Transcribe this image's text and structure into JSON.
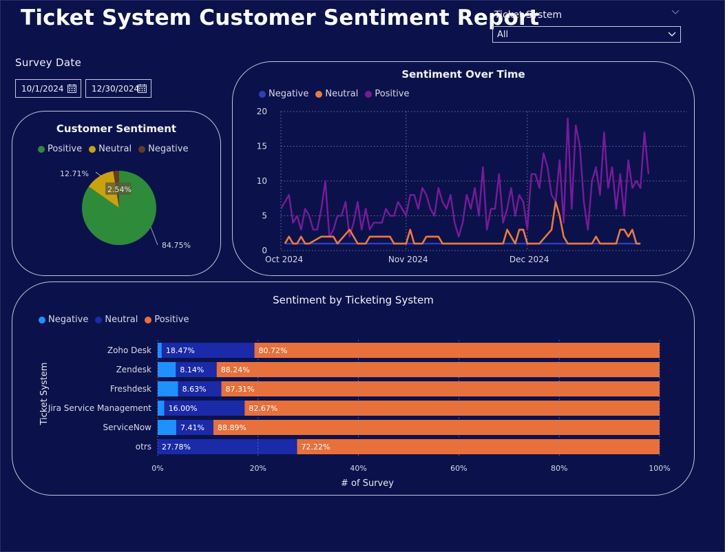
{
  "header": {
    "title": "Ticket System Customer Sentiment Report"
  },
  "ticket_slicer": {
    "label": "Ticket System",
    "value": "All"
  },
  "date_filter": {
    "label": "Survey Date",
    "start": "10/1/2024",
    "end": "12/30/2024"
  },
  "colors": {
    "background": "#0b124b",
    "positive_pie": "#2e8b3a",
    "neutral_pie": "#c9a20e",
    "negative_pie": "#6b3a1e",
    "line_negative": "#2d3fbf",
    "line_neutral": "#ee7a3a",
    "line_positive": "#7a1a9a",
    "bar_negative": "#1e90ff",
    "bar_neutral": "#1a2aa8",
    "bar_positive": "#e8703a"
  },
  "pie_card": {
    "title": "Customer Sentiment",
    "legend": [
      {
        "label": "Positive",
        "color": "#2e8b3a"
      },
      {
        "label": "Neutral",
        "color": "#c9a20e"
      },
      {
        "label": "Negative",
        "color": "#6b3a1e"
      }
    ]
  },
  "line_card": {
    "title": "Sentiment Over Time",
    "legend": [
      {
        "label": "Negative",
        "color": "#2d3fbf"
      },
      {
        "label": "Neutral",
        "color": "#ee7a3a"
      },
      {
        "label": "Positive",
        "color": "#7a1a9a"
      }
    ]
  },
  "bar_card": {
    "title": "Sentiment by Ticketing System",
    "legend": [
      {
        "label": "Negative",
        "color": "#1e90ff"
      },
      {
        "label": "Neutral",
        "color": "#1a2aa8"
      },
      {
        "label": "Positive",
        "color": "#e8703a"
      }
    ]
  },
  "chart_data": [
    {
      "type": "pie",
      "title": "Customer Sentiment",
      "slices": [
        {
          "label": "Positive",
          "value": 84.75,
          "text": "84.75%"
        },
        {
          "label": "Neutral",
          "value": 12.71,
          "text": "12.71%"
        },
        {
          "label": "Negative",
          "value": 2.54,
          "text": "2.54%"
        }
      ]
    },
    {
      "type": "line",
      "title": "Sentiment Over Time",
      "x_ticks": [
        "Oct 2024",
        "Nov 2024",
        "Dec 2024"
      ],
      "x_tick_days": [
        0,
        31,
        61
      ],
      "x_range_days": [
        0,
        90
      ],
      "ylim": [
        0,
        20
      ],
      "y_ticks": [
        0,
        5,
        10,
        15,
        20
      ],
      "grid": true,
      "legend_position": "top-left",
      "series": [
        {
          "name": "Negative",
          "values": [
            [
              1,
              1
            ],
            [
              2,
              1
            ],
            [
              3,
              1
            ],
            [
              4,
              1
            ],
            [
              5,
              1
            ],
            [
              6,
              1
            ],
            [
              7,
              1
            ],
            [
              8,
              1
            ],
            [
              9,
              1
            ],
            [
              10,
              1
            ],
            [
              11,
              1
            ],
            [
              12,
              1
            ],
            [
              13,
              1
            ],
            [
              14,
              1
            ],
            [
              15,
              1
            ],
            [
              16,
              1
            ],
            [
              17,
              1
            ],
            [
              18,
              1
            ],
            [
              19,
              1
            ],
            [
              20,
              1
            ],
            [
              21,
              1
            ],
            [
              22,
              1
            ],
            [
              23,
              1
            ],
            [
              24,
              1
            ],
            [
              25,
              1
            ],
            [
              26,
              1
            ],
            [
              27,
              1
            ],
            [
              28,
              1
            ],
            [
              29,
              1
            ],
            [
              30,
              1
            ],
            [
              31,
              1
            ],
            [
              32,
              1
            ],
            [
              33,
              1
            ],
            [
              34,
              1
            ],
            [
              35,
              1
            ],
            [
              36,
              1
            ],
            [
              37,
              1
            ],
            [
              38,
              1
            ],
            [
              39,
              1
            ],
            [
              40,
              1
            ],
            [
              41,
              1
            ],
            [
              42,
              1
            ],
            [
              43,
              1
            ],
            [
              44,
              1
            ],
            [
              45,
              1
            ],
            [
              46,
              1
            ],
            [
              47,
              1
            ],
            [
              48,
              1
            ],
            [
              49,
              1
            ],
            [
              50,
              1
            ],
            [
              51,
              1
            ],
            [
              52,
              1
            ],
            [
              53,
              1
            ],
            [
              54,
              1
            ],
            [
              55,
              1
            ],
            [
              56,
              1
            ],
            [
              57,
              1
            ],
            [
              58,
              1
            ],
            [
              59,
              1
            ],
            [
              60,
              1
            ],
            [
              61,
              1
            ],
            [
              62,
              1
            ],
            [
              63,
              1
            ],
            [
              64,
              1
            ],
            [
              65,
              1
            ],
            [
              66,
              1
            ],
            [
              67,
              1
            ],
            [
              68,
              1
            ],
            [
              69,
              1
            ],
            [
              70,
              1
            ],
            [
              71,
              1
            ],
            [
              72,
              1
            ],
            [
              73,
              1
            ],
            [
              74,
              1
            ],
            [
              75,
              1
            ],
            [
              76,
              1
            ],
            [
              77,
              1
            ],
            [
              78,
              1
            ],
            [
              79,
              1
            ],
            [
              80,
              1
            ],
            [
              81,
              1
            ],
            [
              82,
              1
            ],
            [
              83,
              1
            ],
            [
              84,
              1
            ],
            [
              85,
              1
            ],
            [
              86,
              1
            ],
            [
              87,
              1
            ],
            [
              88,
              1
            ],
            [
              89,
              1
            ]
          ]
        },
        {
          "name": "Neutral",
          "values": [
            [
              1,
              1
            ],
            [
              2,
              2
            ],
            [
              3,
              1
            ],
            [
              4,
              1
            ],
            [
              5,
              2
            ],
            [
              6,
              1
            ],
            [
              7,
              1
            ],
            [
              10,
              2
            ],
            [
              13,
              2
            ],
            [
              14,
              1
            ],
            [
              17,
              3
            ],
            [
              19,
              1
            ],
            [
              20,
              1
            ],
            [
              21,
              1
            ],
            [
              22,
              2
            ],
            [
              24,
              2
            ],
            [
              27,
              2
            ],
            [
              28,
              1
            ],
            [
              30,
              1
            ],
            [
              31,
              1
            ],
            [
              32,
              3
            ],
            [
              33,
              1
            ],
            [
              35,
              1
            ],
            [
              36,
              2
            ],
            [
              39,
              2
            ],
            [
              40,
              1
            ],
            [
              43,
              1
            ],
            [
              46,
              1
            ],
            [
              49,
              1
            ],
            [
              52,
              1
            ],
            [
              55,
              1
            ],
            [
              56,
              3
            ],
            [
              57,
              2
            ],
            [
              58,
              1
            ],
            [
              59,
              3
            ],
            [
              60,
              3
            ],
            [
              61,
              1
            ],
            [
              64,
              1
            ],
            [
              67,
              3
            ],
            [
              68,
              7
            ],
            [
              69,
              5
            ],
            [
              70,
              2
            ],
            [
              71,
              1
            ],
            [
              74,
              1
            ],
            [
              77,
              1
            ],
            [
              78,
              2
            ],
            [
              79,
              1
            ],
            [
              82,
              1
            ],
            [
              83,
              1
            ],
            [
              84,
              3
            ],
            [
              85,
              3
            ],
            [
              86,
              2
            ],
            [
              87,
              3
            ],
            [
              88,
              1
            ],
            [
              89,
              1
            ]
          ]
        },
        {
          "name": "Positive",
          "values": [
            [
              0,
              6
            ],
            [
              1,
              7
            ],
            [
              2,
              8
            ],
            [
              3,
              4
            ],
            [
              4,
              5
            ],
            [
              5,
              3
            ],
            [
              6,
              6
            ],
            [
              7,
              5
            ],
            [
              8,
              3
            ],
            [
              9,
              3
            ],
            [
              10,
              6
            ],
            [
              11,
              10
            ],
            [
              12,
              2
            ],
            [
              13,
              3
            ],
            [
              14,
              5
            ],
            [
              15,
              5
            ],
            [
              16,
              7
            ],
            [
              17,
              2
            ],
            [
              18,
              4
            ],
            [
              19,
              7
            ],
            [
              20,
              3
            ],
            [
              21,
              6
            ],
            [
              22,
              3
            ],
            [
              23,
              4
            ],
            [
              24,
              4
            ],
            [
              25,
              4
            ],
            [
              26,
              6
            ],
            [
              27,
              5
            ],
            [
              28,
              5
            ],
            [
              29,
              7
            ],
            [
              30,
              6
            ],
            [
              31,
              5
            ],
            [
              32,
              8
            ],
            [
              33,
              8
            ],
            [
              34,
              6
            ],
            [
              35,
              9
            ],
            [
              36,
              8
            ],
            [
              37,
              6
            ],
            [
              38,
              5
            ],
            [
              39,
              9
            ],
            [
              40,
              7
            ],
            [
              41,
              6
            ],
            [
              42,
              8
            ],
            [
              43,
              4
            ],
            [
              44,
              2
            ],
            [
              45,
              4
            ],
            [
              46,
              8
            ],
            [
              47,
              6
            ],
            [
              48,
              9
            ],
            [
              49,
              5
            ],
            [
              50,
              12
            ],
            [
              51,
              3
            ],
            [
              52,
              6
            ],
            [
              53,
              6
            ],
            [
              54,
              11
            ],
            [
              55,
              4
            ],
            [
              56,
              6
            ],
            [
              57,
              9
            ],
            [
              58,
              5
            ],
            [
              59,
              8
            ],
            [
              60,
              7
            ],
            [
              61,
              3
            ],
            [
              62,
              11
            ],
            [
              63,
              11
            ],
            [
              64,
              9
            ],
            [
              65,
              14
            ],
            [
              66,
              12
            ],
            [
              67,
              8
            ],
            [
              68,
              7
            ],
            [
              69,
              13
            ],
            [
              70,
              4
            ],
            [
              71,
              19
            ],
            [
              72,
              6
            ],
            [
              73,
              18
            ],
            [
              74,
              15
            ],
            [
              75,
              7
            ],
            [
              76,
              3
            ],
            [
              77,
              10
            ],
            [
              78,
              12
            ],
            [
              79,
              8
            ],
            [
              80,
              17
            ],
            [
              81,
              9
            ],
            [
              82,
              12
            ],
            [
              83,
              6
            ],
            [
              84,
              11
            ],
            [
              85,
              5
            ],
            [
              86,
              13
            ],
            [
              87,
              9
            ],
            [
              88,
              10
            ],
            [
              89,
              9
            ],
            [
              90,
              17
            ],
            [
              91,
              11
            ]
          ]
        }
      ]
    },
    {
      "type": "bar",
      "orientation": "horizontal",
      "stacked": "100%",
      "title": "Sentiment by Ticketing System",
      "ylabel": "Ticket System",
      "xlabel": "# of Survey",
      "x_ticks": [
        "0%",
        "20%",
        "40%",
        "60%",
        "80%",
        "100%"
      ],
      "xlim": [
        0,
        100
      ],
      "categories": [
        "Zoho Desk",
        "Zendesk",
        "Freshdesk",
        "Jira Service Management",
        "ServiceNow",
        "otrs"
      ],
      "series": [
        {
          "name": "Negative",
          "values": [
            0.81,
            3.62,
            4.06,
            1.33,
            3.7,
            0
          ]
        },
        {
          "name": "Neutral",
          "values": [
            18.47,
            8.14,
            8.63,
            16.0,
            7.41,
            27.78
          ],
          "labels": [
            "18.47%",
            "8.14%",
            "8.63%",
            "16.00%",
            "7.41%",
            "27.78%"
          ]
        },
        {
          "name": "Positive",
          "values": [
            80.72,
            88.24,
            87.31,
            82.67,
            88.89,
            72.22
          ],
          "labels": [
            "80.72%",
            "88.24%",
            "87.31%",
            "82.67%",
            "88.89%",
            "72.22%"
          ]
        }
      ]
    }
  ]
}
